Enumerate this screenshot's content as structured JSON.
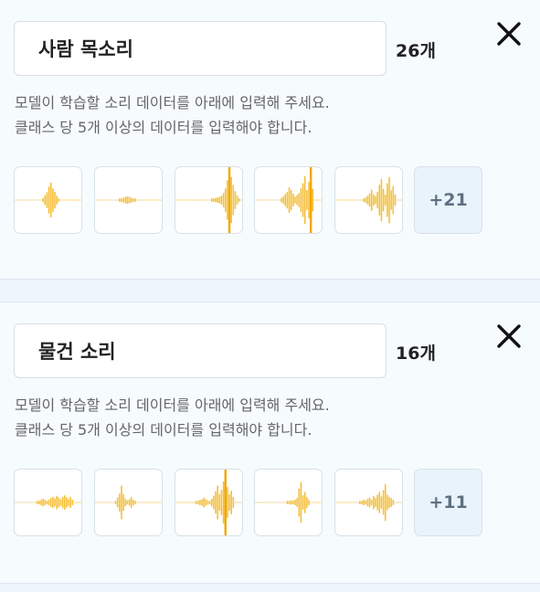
{
  "classes": [
    {
      "name": "사람 목소리",
      "count": "26개",
      "hint_line1": "모델이 학습할 소리 데이터를 아래에 입력해 주세요.",
      "hint_line2": "클래스 당 5개 이상의 데이터를 입력해야 합니다.",
      "more_label": "+21",
      "samples": [
        {
          "amps": [
            0,
            0,
            0,
            0,
            0,
            0,
            0,
            0,
            0,
            0,
            0,
            0,
            0,
            0,
            0.08,
            0.18,
            0.28,
            0.48,
            0.62,
            0.42,
            0.3,
            0.16,
            0.06,
            0,
            0,
            0,
            0,
            0,
            0,
            0,
            0,
            0,
            0,
            0
          ]
        },
        {
          "amps": [
            0,
            0,
            0,
            0,
            0,
            0,
            0,
            0,
            0,
            0,
            0,
            0,
            0.04,
            0.06,
            0.09,
            0.12,
            0.14,
            0.12,
            0.09,
            0.06,
            0.04,
            0,
            0,
            0,
            0,
            0,
            0,
            0,
            0,
            0,
            0,
            0,
            0,
            0
          ]
        },
        {
          "amps": [
            0,
            0,
            0,
            0,
            0,
            0,
            0,
            0,
            0,
            0,
            0,
            0,
            0,
            0,
            0,
            0,
            0,
            0,
            0.04,
            0.06,
            0.08,
            0.1,
            0.12,
            0.16,
            0.26,
            0.42,
            0.7,
            1,
            0.82,
            0.54,
            0.32,
            0.16,
            0.06,
            0
          ]
        },
        {
          "amps": [
            0,
            0,
            0,
            0,
            0,
            0,
            0,
            0,
            0,
            0,
            0,
            0,
            0,
            0.08,
            0.14,
            0.22,
            0.3,
            0.45,
            0.36,
            0.22,
            0.12,
            0.18,
            0.26,
            0.42,
            0.6,
            0.85,
            0.36,
            0.65,
            0.95,
            0.4,
            0,
            0,
            0,
            0
          ]
        },
        {
          "amps": [
            0,
            0,
            0,
            0,
            0,
            0,
            0,
            0,
            0,
            0,
            0,
            0,
            0,
            0,
            0.06,
            0.1,
            0.16,
            0.24,
            0.38,
            0.2,
            0.14,
            0.3,
            0.55,
            0.75,
            0.4,
            0.2,
            0.6,
            0.82,
            0.35,
            0.5,
            0.2,
            0,
            0,
            0
          ]
        }
      ]
    },
    {
      "name": "물건 소리",
      "count": "16개",
      "hint_line1": "모델이 학습할 소리 데이터를 아래에 입력해 주세요.",
      "hint_line2": "클래스 당 5개 이상의 데이터를 입력해야 합니다.",
      "more_label": "+11",
      "samples": [
        {
          "amps": [
            0,
            0,
            0,
            0,
            0,
            0,
            0,
            0,
            0,
            0,
            0,
            0.04,
            0.06,
            0.1,
            0.14,
            0.1,
            0.06,
            0.1,
            0.16,
            0.2,
            0.14,
            0.24,
            0.18,
            0.12,
            0.2,
            0.26,
            0.18,
            0.12,
            0.2,
            0.1,
            0,
            0,
            0,
            0
          ]
        },
        {
          "amps": [
            0,
            0,
            0,
            0,
            0,
            0,
            0,
            0,
            0,
            0,
            0.06,
            0.18,
            0.32,
            0.6,
            0.3,
            0.14,
            0.08,
            0.12,
            0.2,
            0.1,
            0.04,
            0,
            0,
            0,
            0,
            0,
            0,
            0,
            0,
            0,
            0,
            0,
            0,
            0
          ]
        },
        {
          "amps": [
            0,
            0,
            0,
            0,
            0,
            0,
            0,
            0,
            0,
            0,
            0.04,
            0.06,
            0.1,
            0.12,
            0.18,
            0.12,
            0.08,
            0.06,
            0.14,
            0.24,
            0.4,
            0.6,
            0.3,
            0.45,
            0.75,
            1,
            0.55,
            0.3,
            0.42,
            0.2,
            0,
            0,
            0,
            0
          ]
        },
        {
          "amps": [
            0,
            0,
            0,
            0,
            0,
            0,
            0,
            0,
            0,
            0,
            0,
            0,
            0,
            0,
            0,
            0,
            0.04,
            0.06,
            0.08,
            0.06,
            0.1,
            0.16,
            0.5,
            0.72,
            0.26,
            0.38,
            0.2,
            0.1,
            0,
            0,
            0,
            0,
            0,
            0
          ]
        },
        {
          "amps": [
            0,
            0,
            0,
            0,
            0,
            0,
            0,
            0,
            0,
            0,
            0,
            0,
            0.04,
            0.06,
            0.1,
            0.08,
            0.14,
            0.18,
            0.1,
            0.24,
            0.16,
            0.28,
            0.38,
            0.22,
            0.44,
            0.66,
            0.28,
            0.2,
            0.16,
            0.1,
            0,
            0,
            0,
            0
          ]
        }
      ]
    }
  ],
  "colors": {
    "wave": "#f5bf3a",
    "wave_dot": "#f2c75c",
    "playhead": "#f0a800"
  },
  "icons": {
    "close": "close-icon"
  }
}
